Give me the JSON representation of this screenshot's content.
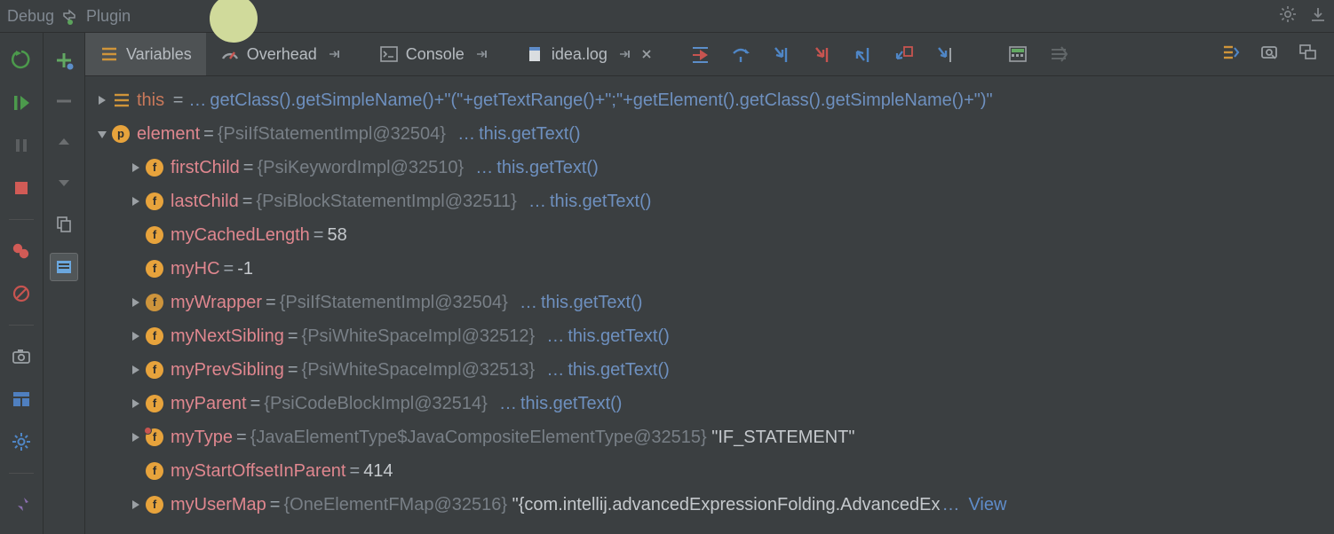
{
  "titlebar": {
    "debug": "Debug",
    "plugin": "Plugin"
  },
  "tabs": {
    "variables": "Variables",
    "overhead": "Overhead",
    "console": "Console",
    "idealog": "idea.log"
  },
  "nodes": {
    "this": {
      "name": "this",
      "eq": "=",
      "dots": "…",
      "expr": "getClass().getSimpleName()+\"(\"+getTextRange()+\";\"+getElement().getClass().getSimpleName()+\")\""
    },
    "element": {
      "name": "element",
      "eq": "=",
      "val": "{PsiIfStatementImpl@32504}",
      "dots": "…",
      "link": "this.getText()"
    },
    "firstChild": {
      "name": "firstChild",
      "eq": "=",
      "val": "{PsiKeywordImpl@32510}",
      "dots": "…",
      "link": "this.getText()"
    },
    "lastChild": {
      "name": "lastChild",
      "eq": "=",
      "val": "{PsiBlockStatementImpl@32511}",
      "dots": "…",
      "link": "this.getText()"
    },
    "myCachedLength": {
      "name": "myCachedLength",
      "eq": "=",
      "val": "58"
    },
    "myHC": {
      "name": "myHC",
      "eq": "=",
      "val": "-1"
    },
    "myWrapper": {
      "name": "myWrapper",
      "eq": "=",
      "val": "{PsiIfStatementImpl@32504}",
      "dots": "…",
      "link": "this.getText()"
    },
    "myNextSibling": {
      "name": "myNextSibling",
      "eq": "=",
      "val": "{PsiWhiteSpaceImpl@32512}",
      "dots": "…",
      "link": "this.getText()"
    },
    "myPrevSibling": {
      "name": "myPrevSibling",
      "eq": "=",
      "val": "{PsiWhiteSpaceImpl@32513}",
      "dots": "…",
      "link": "this.getText()"
    },
    "myParent": {
      "name": "myParent",
      "eq": "=",
      "val": "{PsiCodeBlockImpl@32514}",
      "dots": "…",
      "link": "this.getText()"
    },
    "myType": {
      "name": "myType",
      "eq": "=",
      "val": "{JavaElementType$JavaCompositeElementType@32515}",
      "str": "\"IF_STATEMENT\""
    },
    "myStartOffsetInParent": {
      "name": "myStartOffsetInParent",
      "eq": "=",
      "val": "414"
    },
    "myUserMap": {
      "name": "myUserMap",
      "eq": "=",
      "val": "{OneElementFMap@32516}",
      "str": "\"{com.intellij.advancedExpressionFolding.AdvancedEx",
      "dots": "…",
      "view": "View"
    }
  }
}
